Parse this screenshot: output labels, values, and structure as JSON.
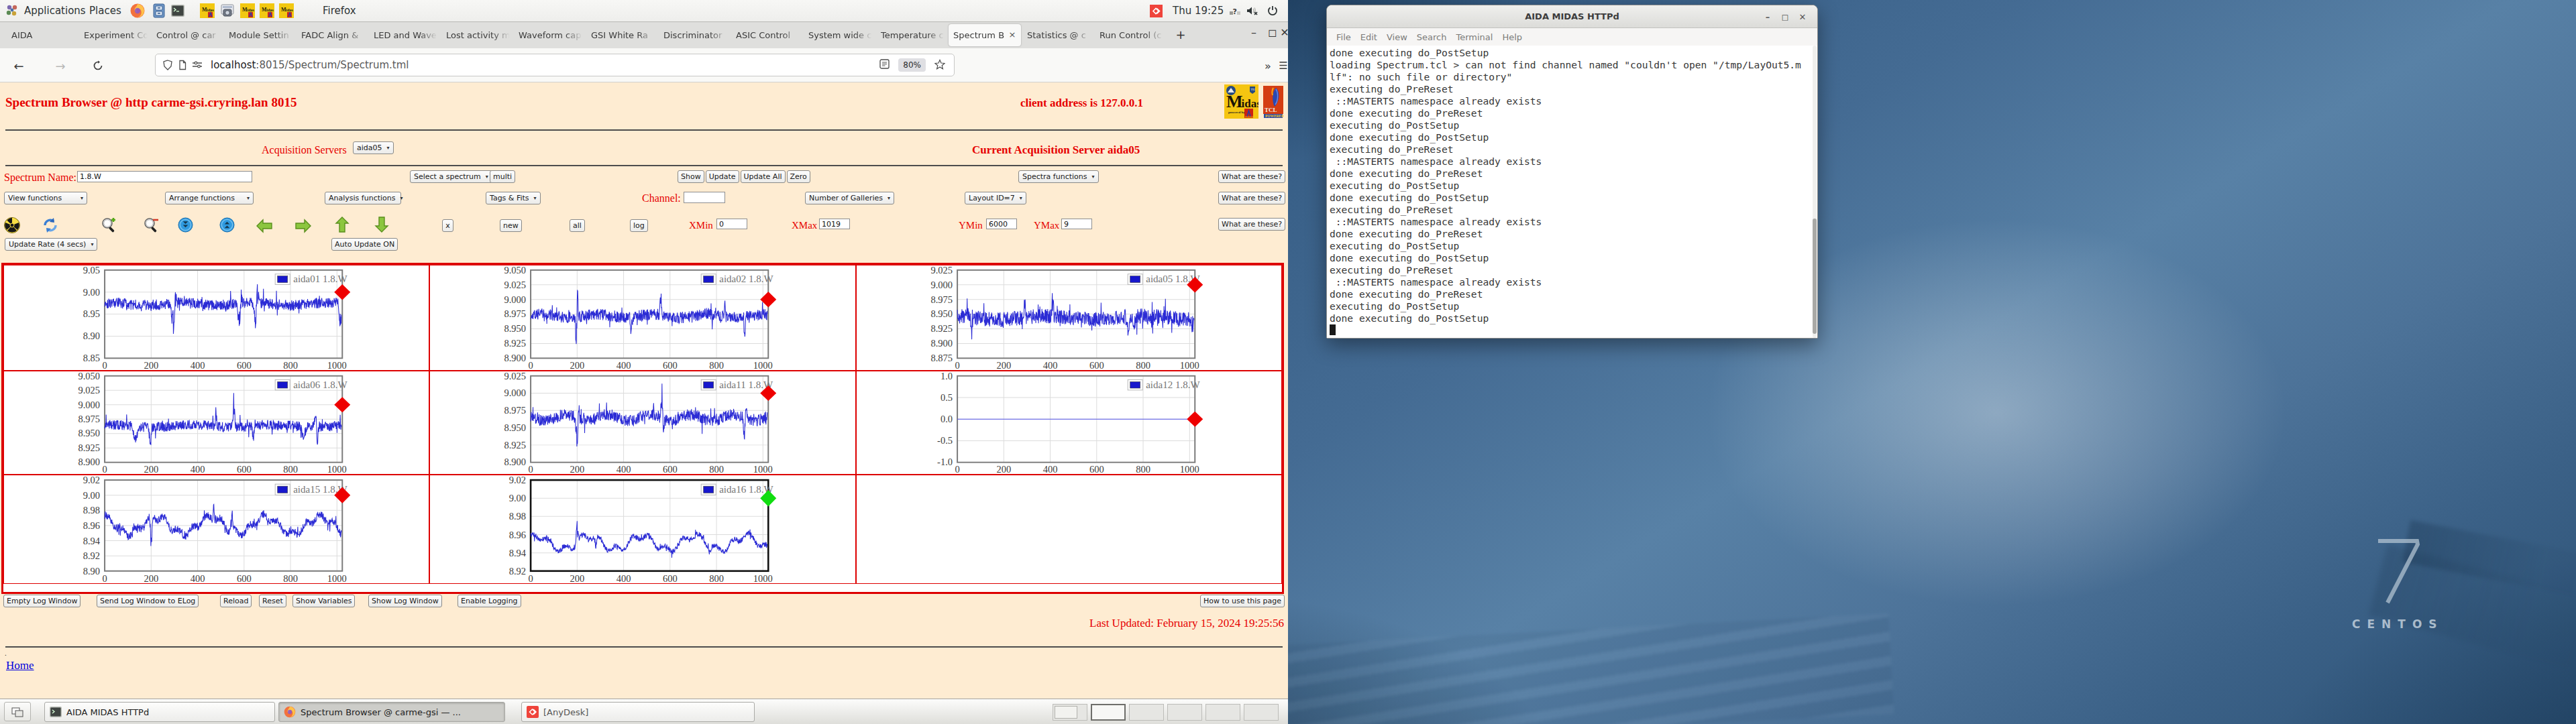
{
  "desktop": {
    "panel": {
      "menus": [
        "Applications",
        "Places"
      ],
      "launchers": [
        "firefox",
        "files",
        "terminal",
        "midas",
        "screenshot",
        "midas",
        "midas",
        "midas"
      ],
      "active_app": "Firefox",
      "clock": "Thu 19:25",
      "tray": [
        "anydesk",
        "keyboard-indicator",
        "volume-muted",
        "power"
      ]
    },
    "taskbar": {
      "tasks": [
        {
          "icon": "terminal",
          "label": "AIDA MIDAS HTTPd",
          "active": false
        },
        {
          "icon": "firefox",
          "label": "Spectrum Browser @ carme-gsi — ...",
          "active": true
        },
        {
          "icon": "anydesk",
          "label": "[AnyDesk]",
          "active": false
        }
      ],
      "workspaces": 6,
      "active_workspace": 2
    }
  },
  "browser": {
    "tabs": [
      {
        "label": "AIDA"
      },
      {
        "label": "Experiment Co"
      },
      {
        "label": "Control @ car"
      },
      {
        "label": "Module Settin"
      },
      {
        "label": "FADC Align &"
      },
      {
        "label": "LED and Wave"
      },
      {
        "label": "Lost activity m"
      },
      {
        "label": "Waveform cap"
      },
      {
        "label": "GSI White Ra"
      },
      {
        "label": "Discriminator"
      },
      {
        "label": "ASIC Control"
      },
      {
        "label": "System wide c"
      },
      {
        "label": "Temperature c"
      },
      {
        "label": "Spectrum B",
        "active": true
      },
      {
        "label": "Statistics @ c"
      },
      {
        "label": "Run Control (c"
      }
    ],
    "tab_close_glyph": "×",
    "new_tab_button": "+",
    "window_buttons": {
      "minimize": "–",
      "restore": "◻",
      "close": "✕"
    },
    "nav": {
      "back": "←",
      "forward": "→",
      "overflow": "»",
      "menu": "☰"
    },
    "url_host": "localhost",
    "url_rest": ":8015/Spectrum/Spectrum.tml",
    "zoom": "80%"
  },
  "page": {
    "title": "Spectrum Browser @ http carme-gsi.cryring.lan 8015",
    "client": "client address is 127.0.0.1",
    "acquisition_label": "Acquisition Servers",
    "acquisition_value": "aida05",
    "current_server": "Current Acquisition Server aida05",
    "spectrum_name_label": "Spectrum Name:",
    "spectrum_name_value": "1.8.W",
    "select_spectrum": "Select a spectrum",
    "multi": "multi",
    "show": "Show",
    "update": "Update",
    "update_all": "Update All",
    "zero": "Zero",
    "spectra_functions": "Spectra functions",
    "what_are_these": "What are these?",
    "view_functions": "View functions",
    "arrange_functions": "Arrange functions",
    "analysis_functions": "Analysis functions",
    "tags_fits": "Tags & Fits",
    "channel_label": "Channel:",
    "channel_value": "",
    "galleries": "Number of Galleries",
    "layout": "Layout ID=7",
    "icon_names": [
      "radioactive-icon",
      "refresh-icon",
      "zoom-in-icon",
      "zoom-out-icon",
      "collapse-icon",
      "expand-icon",
      "arrow-left-icon",
      "arrow-right-icon",
      "arrow-up-icon",
      "arrow-down-icon"
    ],
    "x_button": "x",
    "new_button": "new",
    "all_button": "all",
    "log_button": "log",
    "xmin_label": "XMin",
    "xmin": "0",
    "xmax_label": "XMax",
    "xmax": "1019",
    "ymin_label": "YMin",
    "ymin": "6000",
    "ymax_label": "YMax",
    "ymax": "9",
    "update_rate": "Update Rate (4 secs)",
    "auto_update": "Auto Update ON",
    "footer_buttons": [
      "Empty Log Window",
      "Send Log Window to ELog",
      "Reload",
      "Reset",
      "Show Variables",
      "Show Log Window",
      "Enable Logging"
    ],
    "how_to": "How to use this page",
    "last_updated": "Last Updated: February 15, 2024 19:25:56",
    "home": "Home",
    "logos": {
      "midas": "Midas",
      "midas_sub": "powered by",
      "tcl": "TCL",
      "tcl_sub": "POWERED"
    }
  },
  "chart_data": [
    {
      "type": "line",
      "legend": "aida01 1.8.W",
      "ylim": [
        8.85,
        9.05
      ],
      "yticks": [
        "8.85",
        "8.90",
        "8.95",
        "9.00",
        "9.05"
      ],
      "xticks": [
        0,
        200,
        400,
        600,
        800,
        1000
      ],
      "xmax": 1019,
      "marker": {
        "value": 9.0,
        "color": "#ee0000"
      },
      "line_color": "#2b2bd5",
      "mean": 8.973,
      "noise": 0.0125,
      "wave": {
        "amp": 0.003,
        "period": 310,
        "phase": 1.2
      },
      "spikes": [
        {
          "x": 297,
          "v": 8.897,
          "w": 16
        },
        {
          "x": 306,
          "v": 9.039,
          "w": 7
        },
        {
          "x": 580,
          "v": 8.907,
          "w": 12
        },
        {
          "x": 588,
          "v": 9.028,
          "w": 6
        },
        {
          "x": 650,
          "v": 8.912,
          "w": 14
        },
        {
          "x": 658,
          "v": 9.034,
          "w": 7
        },
        {
          "x": 1014,
          "v": 8.898,
          "w": 9
        }
      ],
      "seed": 101
    },
    {
      "type": "line",
      "legend": "aida02 1.8.W",
      "ylim": [
        8.9,
        9.05
      ],
      "yticks": [
        "8.900",
        "8.925",
        "8.950",
        "8.975",
        "9.000",
        "9.025",
        "9.050"
      ],
      "xticks": [
        0,
        200,
        400,
        600,
        800,
        1000
      ],
      "xmax": 1019,
      "marker": {
        "value": 9.0,
        "color": "#ee0000"
      },
      "line_color": "#2b2bd5",
      "mean": 8.972,
      "noise": 0.0095,
      "wave": {
        "amp": 0.003,
        "period": 240,
        "phase": 0.4
      },
      "spikes": [
        {
          "x": 196,
          "v": 8.908,
          "w": 8
        },
        {
          "x": 202,
          "v": 9.029,
          "w": 5
        },
        {
          "x": 560,
          "v": 9.026,
          "w": 6
        },
        {
          "x": 433,
          "v": 8.933,
          "w": 7
        },
        {
          "x": 836,
          "v": 9.009,
          "w": 5
        },
        {
          "x": 922,
          "v": 8.921,
          "w": 7
        }
      ],
      "seed": 202
    },
    {
      "type": "line",
      "legend": "aida05 1.8.W",
      "ylim": [
        8.875,
        9.025
      ],
      "yticks": [
        "8.875",
        "8.900",
        "8.925",
        "8.950",
        "8.975",
        "9.000",
        "9.025"
      ],
      "xticks": [
        0,
        200,
        400,
        600,
        800,
        1000
      ],
      "xmax": 1019,
      "marker": {
        "value": 9.0,
        "color": "#ee0000"
      },
      "line_color": "#2b2bd5",
      "mean": 8.944,
      "noise": 0.0125,
      "wave": {
        "amp": 0.003,
        "period": 420,
        "phase": 2.1
      },
      "spikes": [
        {
          "x": 62,
          "v": 8.899,
          "w": 7
        },
        {
          "x": 291,
          "v": 9.007,
          "w": 5
        },
        {
          "x": 411,
          "v": 9.018,
          "w": 5
        },
        {
          "x": 735,
          "v": 8.909,
          "w": 12
        },
        {
          "x": 762,
          "v": 8.911,
          "w": 10
        }
      ],
      "seed": 303
    },
    {
      "type": "line",
      "legend": "aida06 1.8.W",
      "ylim": [
        8.9,
        9.05
      ],
      "yticks": [
        "8.900",
        "8.925",
        "8.950",
        "8.975",
        "9.000",
        "9.025",
        "9.050"
      ],
      "xticks": [
        0,
        200,
        400,
        600,
        800,
        1000
      ],
      "xmax": 1019,
      "marker": {
        "value": 9.0,
        "color": "#ee0000"
      },
      "line_color": "#2b2bd5",
      "mean": 8.963,
      "noise": 0.0085,
      "wave": {
        "amp": 0.002,
        "period": 350,
        "phase": 0.9
      },
      "spikes": [
        {
          "x": 132,
          "v": 8.928,
          "w": 18
        },
        {
          "x": 196,
          "v": 8.909,
          "w": 8
        },
        {
          "x": 480,
          "v": 9.004,
          "w": 5
        },
        {
          "x": 556,
          "v": 9.028,
          "w": 7
        },
        {
          "x": 640,
          "v": 8.931,
          "w": 8
        },
        {
          "x": 856,
          "v": 8.926,
          "w": 14
        },
        {
          "x": 906,
          "v": 9.004,
          "w": 8
        },
        {
          "x": 916,
          "v": 8.917,
          "w": 5
        }
      ],
      "seed": 404
    },
    {
      "type": "line",
      "legend": "aida11 1.8.W",
      "ylim": [
        8.9,
        9.025
      ],
      "yticks": [
        "8.900",
        "8.925",
        "8.950",
        "8.975",
        "9.000",
        "9.025"
      ],
      "xticks": [
        0,
        200,
        400,
        600,
        800,
        1000
      ],
      "xmax": 1019,
      "marker": {
        "value": 9.0,
        "color": "#ee0000"
      },
      "line_color": "#2b2bd5",
      "mean": 8.9645,
      "noise": 0.0085,
      "wave": {
        "amp": 0.0045,
        "period": 180,
        "phase": 2.6
      },
      "spikes": [
        {
          "x": 200,
          "v": 8.918,
          "w": 12
        },
        {
          "x": 207,
          "v": 9.007,
          "w": 5
        },
        {
          "x": 565,
          "v": 9.02,
          "w": 7
        },
        {
          "x": 572,
          "v": 8.929,
          "w": 5
        },
        {
          "x": 921,
          "v": 8.917,
          "w": 8
        },
        {
          "x": 927,
          "v": 8.999,
          "w": 5
        }
      ],
      "seed": 505
    },
    {
      "type": "line",
      "legend": "aida12 1.8.W",
      "ylim": [
        -1,
        1
      ],
      "yticks": [
        "-1.0",
        "-0.5",
        "0.0",
        "0.5",
        "1.0"
      ],
      "xticks": [
        0,
        200,
        400,
        600,
        800,
        1000
      ],
      "xmax": 1019,
      "marker": {
        "value": 0.0,
        "color": "#ee0000"
      },
      "line_color": "#5555e8",
      "flat": 0.0
    },
    {
      "type": "line",
      "legend": "aida15 1.8.W",
      "ylim": [
        8.9,
        9.02
      ],
      "yticks": [
        "8.90",
        "8.92",
        "8.94",
        "8.96",
        "8.98",
        "9.00",
        "9.02"
      ],
      "xticks": [
        0,
        200,
        400,
        600,
        800,
        1000
      ],
      "xmax": 1019,
      "marker": {
        "value": 9.0,
        "color": "#ee0000"
      },
      "line_color": "#2b2bd5",
      "mean": 8.9605,
      "noise": 0.005,
      "wave": {
        "amp": 0.0105,
        "period": 235,
        "phase": 1.9
      },
      "wave2": {
        "amp": 0.004,
        "period": 61,
        "phase": 0.3
      },
      "spikes": [
        {
          "x": 200,
          "v": 8.911,
          "w": 7
        },
        {
          "x": 470,
          "v": 8.998,
          "w": 5
        },
        {
          "x": 547,
          "v": 8.999,
          "w": 6
        }
      ],
      "seed": 707
    },
    {
      "type": "line",
      "legend": "aida16 1.8.W",
      "ylim": [
        8.92,
        9.02
      ],
      "yticks": [
        "8.92",
        "8.94",
        "8.96",
        "8.98",
        "9.00",
        "9.02"
      ],
      "xticks": [
        0,
        200,
        400,
        600,
        800,
        1000
      ],
      "xmax": 1019,
      "marker": {
        "value": 9.0,
        "color": "#10dd10"
      },
      "line_color": "#2b2bd5",
      "frame_color": "#111111",
      "selected": true,
      "mean": 8.951,
      "noise": 0.0028,
      "wave": {
        "amp": 0.0075,
        "period": 225,
        "phase": 0.8
      },
      "wave2": {
        "amp": 0.0035,
        "period": 72,
        "phase": 1.1
      },
      "spikes": [
        {
          "x": 200,
          "v": 8.977,
          "w": 9
        },
        {
          "x": 280,
          "v": 8.935,
          "w": 7
        },
        {
          "x": 772,
          "v": 8.934,
          "w": 9
        }
      ],
      "seed": 808
    },
    null
  ],
  "terminal": {
    "title": "AIDA MIDAS HTTPd",
    "menu": [
      "File",
      "Edit",
      "View",
      "Search",
      "Terminal",
      "Help"
    ],
    "lines": [
      "done executing do_PostSetup",
      "loading Spectrum.tcl > can not find channel named \"couldn't open \"/tmp/LayOut5.m",
      "lf\": no such file or directory\"",
      "executing do_PreReset",
      " ::MASTERTS namespace already exists",
      "done executing do_PreReset",
      "executing do_PostSetup",
      "done executing do_PostSetup",
      "executing do_PreReset",
      " ::MASTERTS namespace already exists",
      "done executing do_PreReset",
      "executing do_PostSetup",
      "done executing do_PostSetup",
      "executing do_PreReset",
      " ::MASTERTS namespace already exists",
      "done executing do_PreReset",
      "executing do_PostSetup",
      "done executing do_PostSetup",
      "executing do_PreReset",
      " ::MASTERTS namespace already exists",
      "done executing do_PreReset",
      "executing do_PostSetup",
      "done executing do_PostSetup"
    ]
  },
  "wallpaper": {
    "big_glyph": "7",
    "brand": "CENTOS"
  }
}
